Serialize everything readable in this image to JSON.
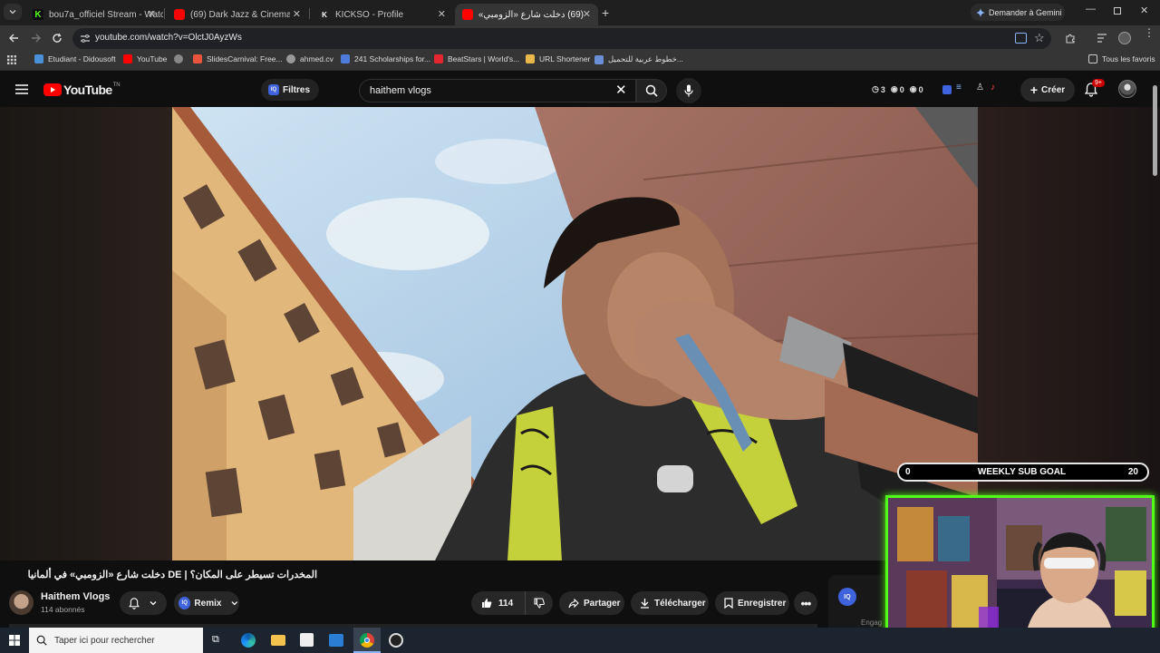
{
  "browser": {
    "tabs": [
      {
        "title": "bou7a_officiel Stream - Watch L",
        "color": "#53fc18"
      },
      {
        "title": "(69) Dark Jazz & Cinematic Trip",
        "color": "#ff0000"
      },
      {
        "title": "KICKSO - Profile",
        "color": "#ffffff"
      },
      {
        "title": "(69) دخلت شارع «الزومبي» د",
        "color": "#ff0000"
      }
    ],
    "gemini_button": "Demander à Gemini",
    "url": "youtube.com/watch?v=OlctJ0AyzWs",
    "bookmarks": [
      {
        "label": "Etudiant - Didousoft",
        "color": "#4a8fd8"
      },
      {
        "label": "YouTube",
        "color": "#ff0000"
      },
      {
        "label": "",
        "color": "#888888"
      },
      {
        "label": "SlidesCarnival: Free...",
        "color": "#e8553c"
      },
      {
        "label": "ahmed.cv",
        "color": "#999999"
      },
      {
        "label": "241 Scholarships for...",
        "color": "#4c7bd9"
      },
      {
        "label": "BeatStars | World's...",
        "color": "#e3262f"
      },
      {
        "label": "URL Shortener",
        "color": "#e8b84a"
      },
      {
        "label": "خطوط عربية للتحميل...",
        "color": "#6b8fd6"
      }
    ],
    "all_bookmarks": "Tous les favoris"
  },
  "youtube": {
    "logo_text": "YouTube",
    "logo_sup": "TN",
    "filters_label": "Filtres",
    "search_value": "haithem vlogs",
    "stats": [
      "3",
      "0",
      "0"
    ],
    "create_label": "Créer",
    "notif_badge": "9+"
  },
  "video": {
    "title": "المخدرات تسيطر على المكان؟ | DE دخلت شارع «الزومبي» في ألمانيا",
    "channel_name": "Haithem Vlogs",
    "subscribers": "114 abonnés",
    "remix_label": "Remix",
    "likes": "114",
    "share_label": "Partager",
    "download_label": "Télécharger",
    "save_label": "Enregistrer",
    "side_label": "Engag"
  },
  "overlay": {
    "sub_goal_current": "0",
    "sub_goal_title": "WEEKLY SUB GOAL",
    "sub_goal_target": "20"
  },
  "taskbar": {
    "search_placeholder": "Taper ici pour rechercher"
  }
}
